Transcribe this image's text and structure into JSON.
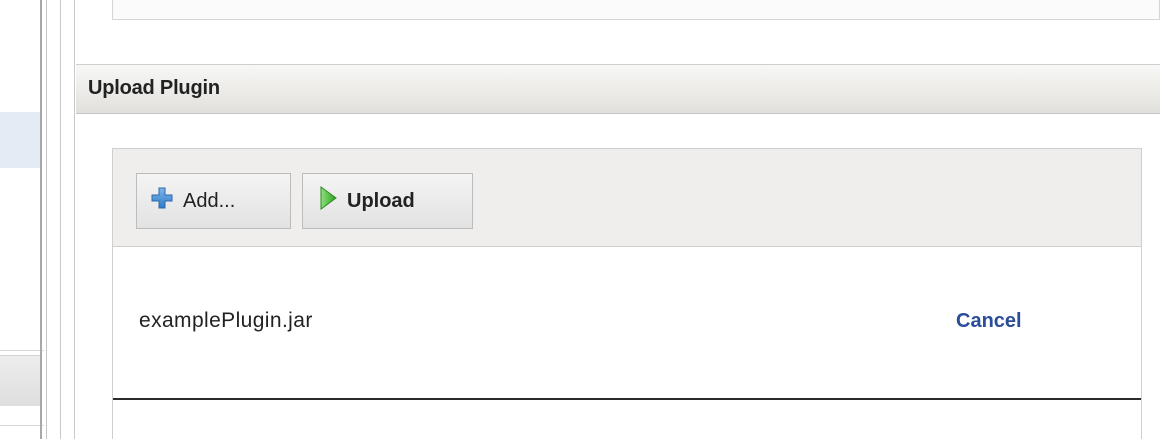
{
  "section": {
    "title": "Upload Plugin"
  },
  "toolbar": {
    "add_label": "Add...",
    "upload_label": "Upload"
  },
  "icons": {
    "add": "plus-icon",
    "upload": "play-arrow-icon"
  },
  "colors": {
    "add_icon": "#3a87d0",
    "upload_icon": "#3dbb2e",
    "cancel_link": "#2a4d9a"
  },
  "files": [
    {
      "name": "examplePlugin.jar",
      "cancel_label": "Cancel"
    }
  ]
}
